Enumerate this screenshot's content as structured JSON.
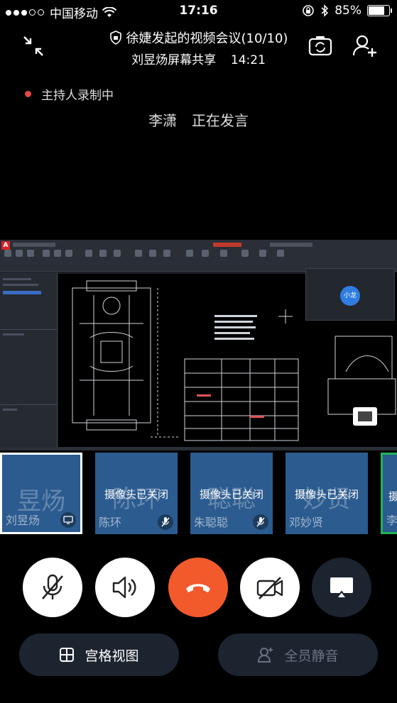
{
  "status_bar": {
    "carrier": "中国移动",
    "time": "17:16",
    "battery": "85%",
    "battery_level": 0.85
  },
  "header": {
    "title": "徐婕发起的视频会议(10/10)",
    "subtitle_sharer": "刘昱炀屏幕共享",
    "subtitle_duration": "14:21"
  },
  "recording": {
    "label": "主持人录制中"
  },
  "speaking": {
    "name": "李潇",
    "status": "正在发言"
  },
  "shared_screen": {
    "video_preview_name": "小龙"
  },
  "participants": [
    {
      "bg_name": "昱炀",
      "name": "刘昱炀",
      "camera_off_label": "",
      "badge_icon": "screen-share-icon",
      "state": "active"
    },
    {
      "bg_name": "陈环",
      "name": "陈环",
      "camera_off_label": "摄像头已关闭",
      "badge_icon": "mic-muted-icon",
      "state": "normal"
    },
    {
      "bg_name": "聪聪",
      "name": "朱聪聪",
      "camera_off_label": "摄像头已关闭",
      "badge_icon": "mic-muted-icon",
      "state": "normal"
    },
    {
      "bg_name": "妙贤",
      "name": "邓妙贤",
      "camera_off_label": "摄像头已关闭",
      "badge_icon": "",
      "state": "normal"
    },
    {
      "bg_name": "",
      "name": "李",
      "camera_off_label": "摄",
      "badge_icon": "",
      "state": "speaking"
    }
  ],
  "controls": {
    "mic": "mic-muted-icon",
    "speaker": "speaker-icon",
    "hangup": "hangup-icon",
    "camera": "camera-off-icon",
    "airplay": "airplay-icon"
  },
  "bottom": {
    "grid_view_label": "宫格视图",
    "mute_all_label": "全员静音"
  },
  "colors": {
    "tile_blue": "#2b5b8f",
    "hangup_red": "#f25a2b",
    "record_red": "#e5473f",
    "speaking_green": "#21b35a"
  }
}
